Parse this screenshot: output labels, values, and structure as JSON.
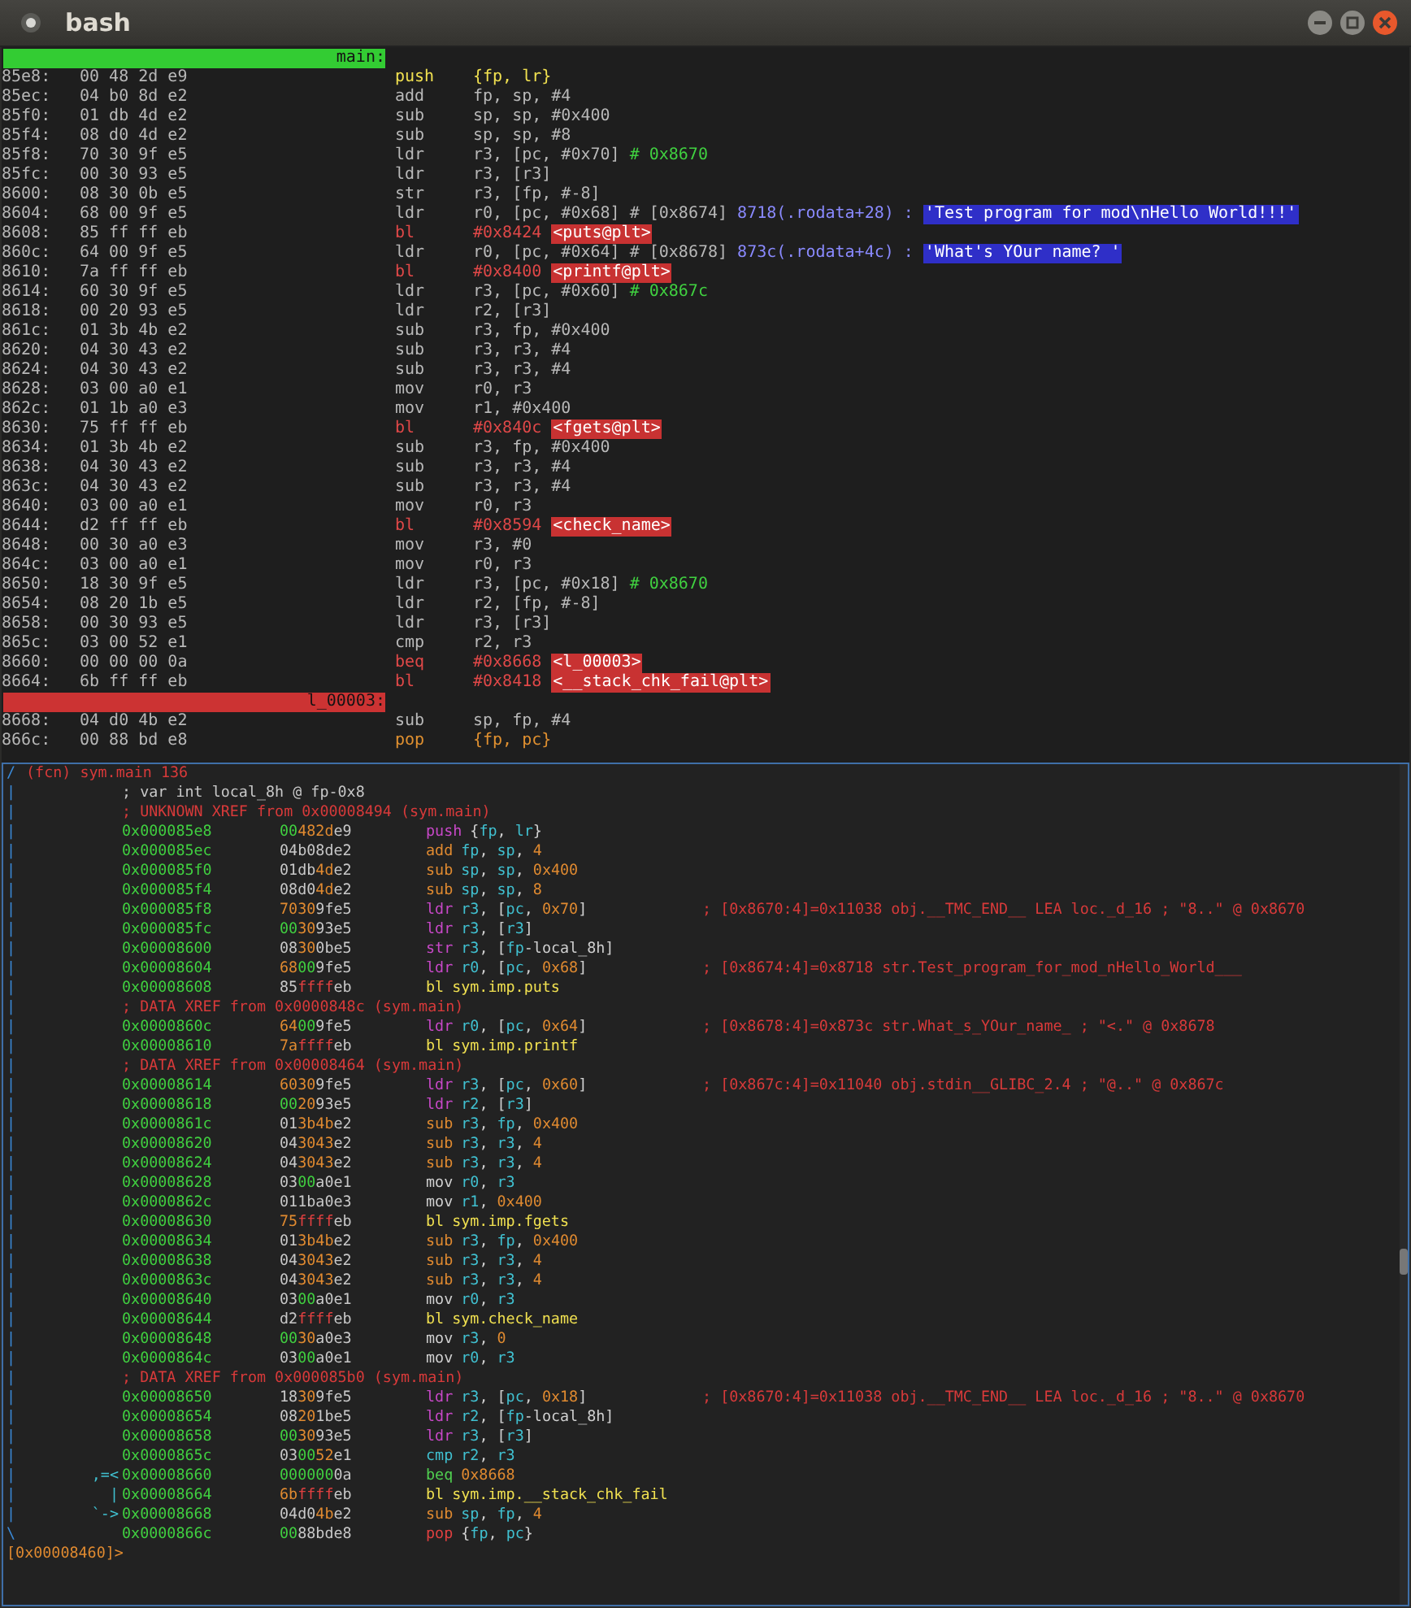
{
  "window": {
    "title": "bash"
  },
  "disassembly": [
    {
      "kind": "label",
      "text": "main:",
      "color": "#33cc33"
    },
    {
      "kind": "insn",
      "addr": "85e8:",
      "bytes": "00 48 2d e9",
      "mnemonic": "push",
      "operands": "{fp, lr}",
      "color": "#f0e050"
    },
    {
      "kind": "insn",
      "addr": "85ec:",
      "bytes": "04 b0 8d e2",
      "mnemonic": "add",
      "operands": "fp, sp, #4",
      "color": "#b8b8b8"
    },
    {
      "kind": "insn",
      "addr": "85f0:",
      "bytes": "01 db 4d e2",
      "mnemonic": "sub",
      "operands": "sp, sp, #0x400",
      "color": "#b8b8b8"
    },
    {
      "kind": "insn",
      "addr": "85f4:",
      "bytes": "08 d0 4d e2",
      "mnemonic": "sub",
      "operands": "sp, sp, #8",
      "color": "#b8b8b8"
    },
    {
      "kind": "insn",
      "addr": "85f8:",
      "bytes": "70 30 9f e5",
      "mnemonic": "ldr",
      "operands": "r3, [pc, #0x70]",
      "color": "#b8b8b8",
      "comment": "# 0x8670"
    },
    {
      "kind": "insn",
      "addr": "85fc:",
      "bytes": "00 30 93 e5",
      "mnemonic": "ldr",
      "operands": "r3, [r3]",
      "color": "#b8b8b8"
    },
    {
      "kind": "insn",
      "addr": "8600:",
      "bytes": "08 30 0b e5",
      "mnemonic": "str",
      "operands": "r3, [fp, #-8]",
      "color": "#b8b8b8"
    },
    {
      "kind": "insn",
      "addr": "8604:",
      "bytes": "68 00 9f e5",
      "mnemonic": "ldr",
      "operands": "r0, [pc, #0x68] # [0x8674]",
      "color": "#b8b8b8",
      "ref": "8718(.rodata+28) :",
      "string": "'Test program for mod\\nHello World!!!'"
    },
    {
      "kind": "insn",
      "addr": "8608:",
      "bytes": "85 ff ff eb",
      "mnemonic": "bl",
      "operands": "#0x8424",
      "color": "#e04848",
      "target": "<puts@plt>"
    },
    {
      "kind": "insn",
      "addr": "860c:",
      "bytes": "64 00 9f e5",
      "mnemonic": "ldr",
      "operands": "r0, [pc, #0x64] # [0x8678]",
      "color": "#b8b8b8",
      "ref": "873c(.rodata+4c) :",
      "string": "'What's YOur name? '"
    },
    {
      "kind": "insn",
      "addr": "8610:",
      "bytes": "7a ff ff eb",
      "mnemonic": "bl",
      "operands": "#0x8400",
      "color": "#e04848",
      "target": "<printf@plt>"
    },
    {
      "kind": "insn",
      "addr": "8614:",
      "bytes": "60 30 9f e5",
      "mnemonic": "ldr",
      "operands": "r3, [pc, #0x60]",
      "color": "#b8b8b8",
      "comment": "# 0x867c"
    },
    {
      "kind": "insn",
      "addr": "8618:",
      "bytes": "00 20 93 e5",
      "mnemonic": "ldr",
      "operands": "r2, [r3]",
      "color": "#b8b8b8"
    },
    {
      "kind": "insn",
      "addr": "861c:",
      "bytes": "01 3b 4b e2",
      "mnemonic": "sub",
      "operands": "r3, fp, #0x400",
      "color": "#b8b8b8"
    },
    {
      "kind": "insn",
      "addr": "8620:",
      "bytes": "04 30 43 e2",
      "mnemonic": "sub",
      "operands": "r3, r3, #4",
      "color": "#b8b8b8"
    },
    {
      "kind": "insn",
      "addr": "8624:",
      "bytes": "04 30 43 e2",
      "mnemonic": "sub",
      "operands": "r3, r3, #4",
      "color": "#b8b8b8"
    },
    {
      "kind": "insn",
      "addr": "8628:",
      "bytes": "03 00 a0 e1",
      "mnemonic": "mov",
      "operands": "r0, r3",
      "color": "#b8b8b8"
    },
    {
      "kind": "insn",
      "addr": "862c:",
      "bytes": "01 1b a0 e3",
      "mnemonic": "mov",
      "operands": "r1, #0x400",
      "color": "#b8b8b8"
    },
    {
      "kind": "insn",
      "addr": "8630:",
      "bytes": "75 ff ff eb",
      "mnemonic": "bl",
      "operands": "#0x840c",
      "color": "#e04848",
      "target": "<fgets@plt>"
    },
    {
      "kind": "insn",
      "addr": "8634:",
      "bytes": "01 3b 4b e2",
      "mnemonic": "sub",
      "operands": "r3, fp, #0x400",
      "color": "#b8b8b8"
    },
    {
      "kind": "insn",
      "addr": "8638:",
      "bytes": "04 30 43 e2",
      "mnemonic": "sub",
      "operands": "r3, r3, #4",
      "color": "#b8b8b8"
    },
    {
      "kind": "insn",
      "addr": "863c:",
      "bytes": "04 30 43 e2",
      "mnemonic": "sub",
      "operands": "r3, r3, #4",
      "color": "#b8b8b8"
    },
    {
      "kind": "insn",
      "addr": "8640:",
      "bytes": "03 00 a0 e1",
      "mnemonic": "mov",
      "operands": "r0, r3",
      "color": "#b8b8b8"
    },
    {
      "kind": "insn",
      "addr": "8644:",
      "bytes": "d2 ff ff eb",
      "mnemonic": "bl",
      "operands": "#0x8594",
      "color": "#e04848",
      "target": "<check_name>"
    },
    {
      "kind": "insn",
      "addr": "8648:",
      "bytes": "00 30 a0 e3",
      "mnemonic": "mov",
      "operands": "r3, #0",
      "color": "#b8b8b8"
    },
    {
      "kind": "insn",
      "addr": "864c:",
      "bytes": "03 00 a0 e1",
      "mnemonic": "mov",
      "operands": "r0, r3",
      "color": "#b8b8b8"
    },
    {
      "kind": "insn",
      "addr": "8650:",
      "bytes": "18 30 9f e5",
      "mnemonic": "ldr",
      "operands": "r3, [pc, #0x18]",
      "color": "#b8b8b8",
      "comment": "# 0x8670"
    },
    {
      "kind": "insn",
      "addr": "8654:",
      "bytes": "08 20 1b e5",
      "mnemonic": "ldr",
      "operands": "r2, [fp, #-8]",
      "color": "#b8b8b8"
    },
    {
      "kind": "insn",
      "addr": "8658:",
      "bytes": "00 30 93 e5",
      "mnemonic": "ldr",
      "operands": "r3, [r3]",
      "color": "#b8b8b8"
    },
    {
      "kind": "insn",
      "addr": "865c:",
      "bytes": "03 00 52 e1",
      "mnemonic": "cmp",
      "operands": "r2, r3",
      "color": "#b8b8b8"
    },
    {
      "kind": "insn",
      "addr": "8660:",
      "bytes": "00 00 00 0a",
      "mnemonic": "beq",
      "operands": "#0x8668",
      "color": "#e04848",
      "target": "<l_00003>"
    },
    {
      "kind": "insn",
      "addr": "8664:",
      "bytes": "6b ff ff eb",
      "mnemonic": "bl",
      "operands": "#0x8418",
      "color": "#e04848",
      "target": "<__stack_chk_fail@plt>"
    },
    {
      "kind": "label",
      "text": "l_00003:",
      "color": "#cc3333"
    },
    {
      "kind": "insn",
      "addr": "8668:",
      "bytes": "04 d0 4b e2",
      "mnemonic": "sub",
      "operands": "sp, fp, #4",
      "color": "#b8b8b8"
    },
    {
      "kind": "insn",
      "addr": "866c:",
      "bytes": "00 88 bd e8",
      "mnemonic": "pop",
      "operands": "{fp, pc}",
      "color": "#e09030"
    }
  ],
  "console": [
    {
      "kind": "header",
      "gutter": "/",
      "text": "(fcn) sym.main 136"
    },
    {
      "kind": "note",
      "gutter": "|",
      "text": "; var int local_8h @ fp-0x8",
      "color": "#c8c8c8"
    },
    {
      "kind": "note",
      "gutter": "|",
      "text": "; UNKNOWN XREF from 0x00008494 (sym.main)",
      "color": "#d83a3a"
    },
    {
      "kind": "insn",
      "gutter": "|",
      "addr": "0x000085e8",
      "bytes": "00482de9",
      "mnemonic": "push",
      "operands": "{fp, lr}",
      "color": "#c848c8"
    },
    {
      "kind": "insn",
      "gutter": "|",
      "addr": "0x000085ec",
      "bytes": "04b08de2",
      "mnemonic": "add",
      "operands": "fp, sp, 4",
      "color": "#e08a30"
    },
    {
      "kind": "insn",
      "gutter": "|",
      "addr": "0x000085f0",
      "bytes": "01db4de2",
      "mnemonic": "sub",
      "operands": "sp, sp, 0x400",
      "color": "#e08a30"
    },
    {
      "kind": "insn",
      "gutter": "|",
      "addr": "0x000085f4",
      "bytes": "08d04de2",
      "mnemonic": "sub",
      "operands": "sp, sp, 8",
      "color": "#e08a30"
    },
    {
      "kind": "insn",
      "gutter": "|",
      "addr": "0x000085f8",
      "bytes": "70309fe5",
      "mnemonic": "ldr",
      "operands": "r3, [pc, 0x70]",
      "color": "#c848c8",
      "comment": "; [0x8670:4]=0x11038 obj.__TMC_END__ LEA loc._d_16 ; \"8..\" @ 0x8670"
    },
    {
      "kind": "insn",
      "gutter": "|",
      "addr": "0x000085fc",
      "bytes": "003093e5",
      "mnemonic": "ldr",
      "operands": "r3, [r3]",
      "color": "#c848c8"
    },
    {
      "kind": "insn",
      "gutter": "|",
      "addr": "0x00008600",
      "bytes": "08300be5",
      "mnemonic": "str",
      "operands": "r3, [fp-local_8h]",
      "color": "#c848c8"
    },
    {
      "kind": "insn",
      "gutter": "|",
      "addr": "0x00008604",
      "bytes": "68009fe5",
      "mnemonic": "ldr",
      "operands": "r0, [pc, 0x68]",
      "color": "#c848c8",
      "comment": "; [0x8674:4]=0x8718 str.Test_program_for_mod_nHello_World___"
    },
    {
      "kind": "insn",
      "gutter": "|",
      "addr": "0x00008608",
      "bytes": "85ffffeb",
      "mnemonic": "bl",
      "operands": "sym.imp.puts",
      "color": "#f0e050",
      "call": true
    },
    {
      "kind": "note",
      "gutter": "|",
      "text": "; DATA XREF from 0x0000848c (sym.main)",
      "color": "#d83a3a"
    },
    {
      "kind": "insn",
      "gutter": "|",
      "addr": "0x0000860c",
      "bytes": "64009fe5",
      "mnemonic": "ldr",
      "operands": "r0, [pc, 0x64]",
      "color": "#c848c8",
      "comment": "; [0x8678:4]=0x873c str.What_s_YOur_name_ ; \"<.\" @ 0x8678"
    },
    {
      "kind": "insn",
      "gutter": "|",
      "addr": "0x00008610",
      "bytes": "7affffeb",
      "mnemonic": "bl",
      "operands": "sym.imp.printf",
      "color": "#f0e050",
      "call": true
    },
    {
      "kind": "note",
      "gutter": "|",
      "text": "; DATA XREF from 0x00008464 (sym.main)",
      "color": "#d83a3a"
    },
    {
      "kind": "insn",
      "gutter": "|",
      "addr": "0x00008614",
      "bytes": "60309fe5",
      "mnemonic": "ldr",
      "operands": "r3, [pc, 0x60]",
      "color": "#c848c8",
      "comment": "; [0x867c:4]=0x11040 obj.stdin__GLIBC_2.4 ; \"@..\" @ 0x867c"
    },
    {
      "kind": "insn",
      "gutter": "|",
      "addr": "0x00008618",
      "bytes": "002093e5",
      "mnemonic": "ldr",
      "operands": "r2, [r3]",
      "color": "#c848c8"
    },
    {
      "kind": "insn",
      "gutter": "|",
      "addr": "0x0000861c",
      "bytes": "013b4be2",
      "mnemonic": "sub",
      "operands": "r3, fp, 0x400",
      "color": "#e08a30"
    },
    {
      "kind": "insn",
      "gutter": "|",
      "addr": "0x00008620",
      "bytes": "043043e2",
      "mnemonic": "sub",
      "operands": "r3, r3, 4",
      "color": "#e08a30"
    },
    {
      "kind": "insn",
      "gutter": "|",
      "addr": "0x00008624",
      "bytes": "043043e2",
      "mnemonic": "sub",
      "operands": "r3, r3, 4",
      "color": "#e08a30"
    },
    {
      "kind": "insn",
      "gutter": "|",
      "addr": "0x00008628",
      "bytes": "0300a0e1",
      "mnemonic": "mov",
      "operands": "r0, r3",
      "color": "#d0d0d0"
    },
    {
      "kind": "insn",
      "gutter": "|",
      "addr": "0x0000862c",
      "bytes": "011ba0e3",
      "mnemonic": "mov",
      "operands": "r1, 0x400",
      "color": "#d0d0d0"
    },
    {
      "kind": "insn",
      "gutter": "|",
      "addr": "0x00008630",
      "bytes": "75ffffeb",
      "mnemonic": "bl",
      "operands": "sym.imp.fgets",
      "color": "#f0e050",
      "call": true
    },
    {
      "kind": "insn",
      "gutter": "|",
      "addr": "0x00008634",
      "bytes": "013b4be2",
      "mnemonic": "sub",
      "operands": "r3, fp, 0x400",
      "color": "#e08a30"
    },
    {
      "kind": "insn",
      "gutter": "|",
      "addr": "0x00008638",
      "bytes": "043043e2",
      "mnemonic": "sub",
      "operands": "r3, r3, 4",
      "color": "#e08a30"
    },
    {
      "kind": "insn",
      "gutter": "|",
      "addr": "0x0000863c",
      "bytes": "043043e2",
      "mnemonic": "sub",
      "operands": "r3, r3, 4",
      "color": "#e08a30"
    },
    {
      "kind": "insn",
      "gutter": "|",
      "addr": "0x00008640",
      "bytes": "0300a0e1",
      "mnemonic": "mov",
      "operands": "r0, r3",
      "color": "#d0d0d0"
    },
    {
      "kind": "insn",
      "gutter": "|",
      "addr": "0x00008644",
      "bytes": "d2ffffeb",
      "mnemonic": "bl",
      "operands": "sym.check_name",
      "color": "#f0e050",
      "call": true
    },
    {
      "kind": "insn",
      "gutter": "|",
      "addr": "0x00008648",
      "bytes": "0030a0e3",
      "mnemonic": "mov",
      "operands": "r3, 0",
      "color": "#d0d0d0"
    },
    {
      "kind": "insn",
      "gutter": "|",
      "addr": "0x0000864c",
      "bytes": "0300a0e1",
      "mnemonic": "mov",
      "operands": "r0, r3",
      "color": "#d0d0d0"
    },
    {
      "kind": "note",
      "gutter": "|",
      "text": "; DATA XREF from 0x000085b0 (sym.main)",
      "color": "#d83a3a"
    },
    {
      "kind": "insn",
      "gutter": "|",
      "addr": "0x00008650",
      "bytes": "18309fe5",
      "mnemonic": "ldr",
      "operands": "r3, [pc, 0x18]",
      "color": "#c848c8",
      "comment": "; [0x8670:4]=0x11038 obj.__TMC_END__ LEA loc._d_16 ; \"8..\" @ 0x8670"
    },
    {
      "kind": "insn",
      "gutter": "|",
      "addr": "0x00008654",
      "bytes": "08201be5",
      "mnemonic": "ldr",
      "operands": "r2, [fp-local_8h]",
      "color": "#c848c8"
    },
    {
      "kind": "insn",
      "gutter": "|",
      "addr": "0x00008658",
      "bytes": "003093e5",
      "mnemonic": "ldr",
      "operands": "r3, [r3]",
      "color": "#c848c8"
    },
    {
      "kind": "insn",
      "gutter": "|",
      "addr": "0x0000865c",
      "bytes": "030052e1",
      "mnemonic": "cmp",
      "operands": "r2, r3",
      "color": "#40c0d0"
    },
    {
      "kind": "insn",
      "gutter": "|",
      "arrow": ",=<",
      "addr": "0x00008660",
      "bytes": "0000000a",
      "mnemonic": "beq",
      "operands": "0x8668",
      "color": "#50d050"
    },
    {
      "kind": "insn",
      "gutter": "|",
      "arrow": "|",
      "addr": "0x00008664",
      "bytes": "6bffffeb",
      "mnemonic": "bl",
      "operands": "sym.imp.__stack_chk_fail",
      "color": "#f0e050",
      "call": true
    },
    {
      "kind": "insn",
      "gutter": "|",
      "arrow": "`->",
      "addr": "0x00008668",
      "bytes": "04d04be2",
      "mnemonic": "sub",
      "operands": "sp, fp, 4",
      "color": "#e08a30"
    },
    {
      "kind": "insn",
      "gutter": "\\",
      "addr": "0x0000866c",
      "bytes": "0088bde8",
      "mnemonic": "pop",
      "operands": "{fp, pc}",
      "color": "#e04040"
    },
    {
      "kind": "prompt",
      "text": "[0x00008460]>"
    }
  ]
}
